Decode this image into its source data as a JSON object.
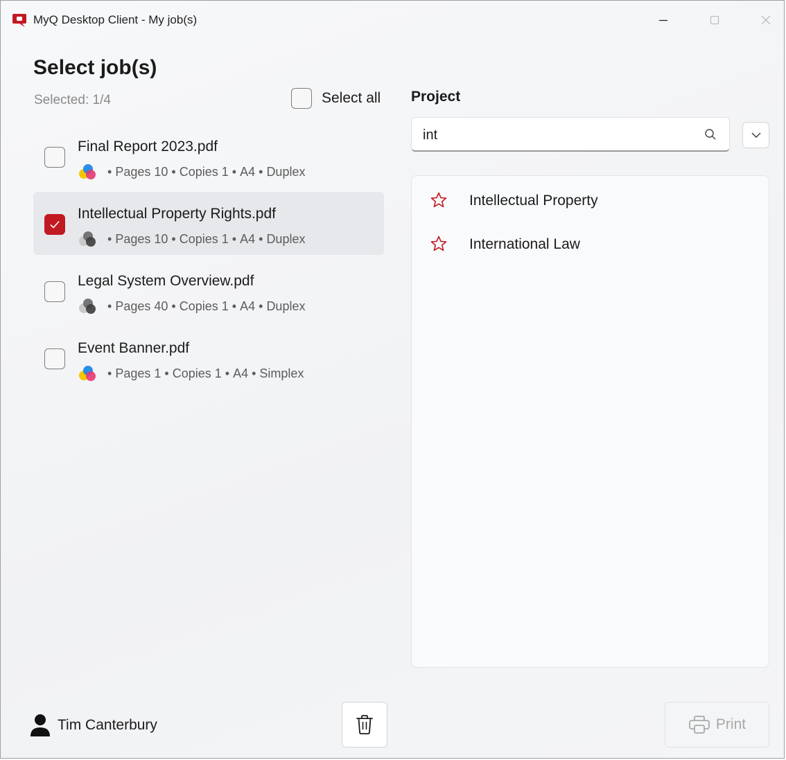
{
  "window": {
    "title": "MyQ Desktop Client - My job(s)",
    "accent_color": "#c11922"
  },
  "header": {
    "title": "Select job(s)",
    "selected_text": "Selected: 1/4",
    "select_all_label": "Select all"
  },
  "jobs": [
    {
      "name": "Final Report 2023.pdf",
      "color_mode": "color",
      "pages_label": "Pages",
      "pages": "10",
      "copies_label": "Copies",
      "copies": "1",
      "paper": "A4",
      "sides": "Duplex",
      "selected": false
    },
    {
      "name": "Intellectual Property Rights.pdf",
      "color_mode": "grayscale",
      "pages_label": "Pages",
      "pages": "10",
      "copies_label": "Copies",
      "copies": "1",
      "paper": "A4",
      "sides": "Duplex",
      "selected": true
    },
    {
      "name": "Legal System Overview.pdf",
      "color_mode": "grayscale",
      "pages_label": "Pages",
      "pages": "40",
      "copies_label": "Copies",
      "copies": "1",
      "paper": "A4",
      "sides": "Duplex",
      "selected": false
    },
    {
      "name": "Event Banner.pdf",
      "color_mode": "color",
      "pages_label": "Pages",
      "pages": "1",
      "copies_label": "Copies",
      "copies": "1",
      "paper": "A4",
      "sides": "Simplex",
      "selected": false
    }
  ],
  "project": {
    "label": "Project",
    "search_value": "int",
    "results": [
      {
        "name": "Intellectual Property",
        "icon": "star-outline-icon"
      },
      {
        "name": "International Law",
        "icon": "star-outline-icon"
      }
    ]
  },
  "footer": {
    "user_name": "Tim Canterbury",
    "print_label": "Print"
  }
}
